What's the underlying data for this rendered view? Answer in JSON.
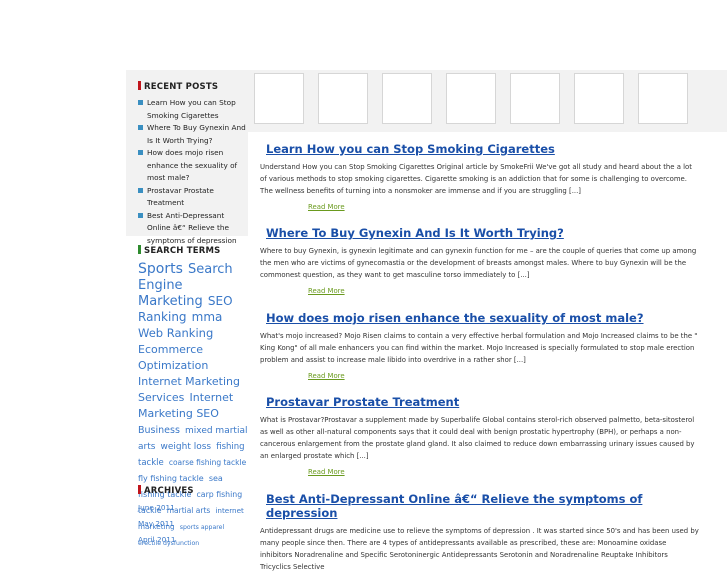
{
  "sidebar": {
    "recent_title": "RECENT POSTS",
    "recent_posts": [
      "Learn How you can Stop Smoking Cigarettes",
      "Where To Buy Gynexin And Is It Worth Trying?",
      "How does mojo risen enhance the sexuality of most male?",
      "Prostavar Prostate Treatment",
      "Best Anti-Depressant Online â€“ Relieve the symptoms of depression"
    ],
    "search_title": "SEARCH TERMS",
    "search_terms": [
      {
        "text": "Sports",
        "size": 14
      },
      {
        "text": "Search Engine Marketing",
        "size": 13
      },
      {
        "text": "SEO Ranking",
        "size": 12
      },
      {
        "text": "mma",
        "size": 12
      },
      {
        "text": "Web Ranking",
        "size": 11.5
      },
      {
        "text": "Ecommerce Optimization",
        "size": 11
      },
      {
        "text": "Internet Marketing Services",
        "size": 11
      },
      {
        "text": "Internet Marketing SEO",
        "size": 11
      },
      {
        "text": "Business",
        "size": 9.5
      },
      {
        "text": "mixed martial arts",
        "size": 9
      },
      {
        "text": "weight loss",
        "size": 9
      },
      {
        "text": "fishing tackle",
        "size": 8.5
      },
      {
        "text": "coarse fishing tackle",
        "size": 7.5
      },
      {
        "text": "fly fishing tackle",
        "size": 8
      },
      {
        "text": "sea fishing tackle",
        "size": 8
      },
      {
        "text": "carp fishing tackle",
        "size": 7.8
      },
      {
        "text": "martial arts",
        "size": 7.5
      },
      {
        "text": "internet marketing",
        "size": 7.2
      },
      {
        "text": "sports apparel",
        "size": 6.2
      },
      {
        "text": "erectile dysfunction",
        "size": 6.2
      }
    ],
    "archives_title": "ARCHIVES",
    "archives": [
      "June 2011",
      "May 2011",
      "April 2011"
    ]
  },
  "posts": [
    {
      "title": "Learn How you can Stop Smoking Cigarettes",
      "excerpt": "Understand How you can Stop Smoking Cigarettes Original article by SmokeFrii We've got all study and heard about the a lot of various methods to stop smoking cigarettes. Cigarette smoking is an addiction that for some is challenging to overcome. The wellness benefits of turning into a nonsmoker are immense and if you are struggling [...]",
      "more": "Read More"
    },
    {
      "title": "Where To Buy Gynexin And Is It Worth Trying?",
      "excerpt": "Where to buy Gynexin, is gynexin legitimate and can gynexin function for me – are the couple of queries that come up among the men who are victims of gynecomastia or the development of breasts amongst males. Where to buy Gynexin will be the commonest question, as they want to get masculine torso immediately to [...]",
      "more": "Read More"
    },
    {
      "title": "How does mojo risen enhance the sexuality of most male?",
      "excerpt": "What's mojo increased? Mojo Risen claims to contain a very effective herbal formulation and Mojo Increased claims to be the \" King Kong\" of all male enhancers you can find within the market. Mojo Increased is specially formulated to stop male erection problem and assist to increase male libido into overdrive in a rather shor [...]",
      "more": "Read More"
    },
    {
      "title": "Prostavar Prostate Treatment",
      "excerpt": "What is Prostavar?Prostavar a supplement made by Superbalife Global contains sterol-rich observed palmetto, beta-sitosterol as well as other all-natural components says that it could deal with benign prostatic hypertrophy (BPH), or perhaps a non-cancerous enlargement from the prostate gland gland. It also claimed to reduce down embarrassing urinary issues caused by an enlarged prostate which [...]",
      "more": "Read More"
    },
    {
      "title": "Best Anti-Depressant Online â€“ Relieve the symptoms of depression",
      "excerpt": "Antidepressant drugs are medicine use to relieve the symptoms of depression . It was started since 50's and has been used by many people since then. There are 4 types of antidepressants available as prescribed, these are:   Monoamine oxidase inhibitors Noradrenaline and Specific Serotoninergic Antidepressants Serotonin and Noradrenaline Reuptake Inhibitors Tricyclics Selective",
      "more": ""
    }
  ],
  "colors": {
    "accent_red": "#c0151c",
    "accent_green": "#2e8b2e",
    "link_blue": "#1a4fa8",
    "more_green": "#6a9a1e"
  }
}
